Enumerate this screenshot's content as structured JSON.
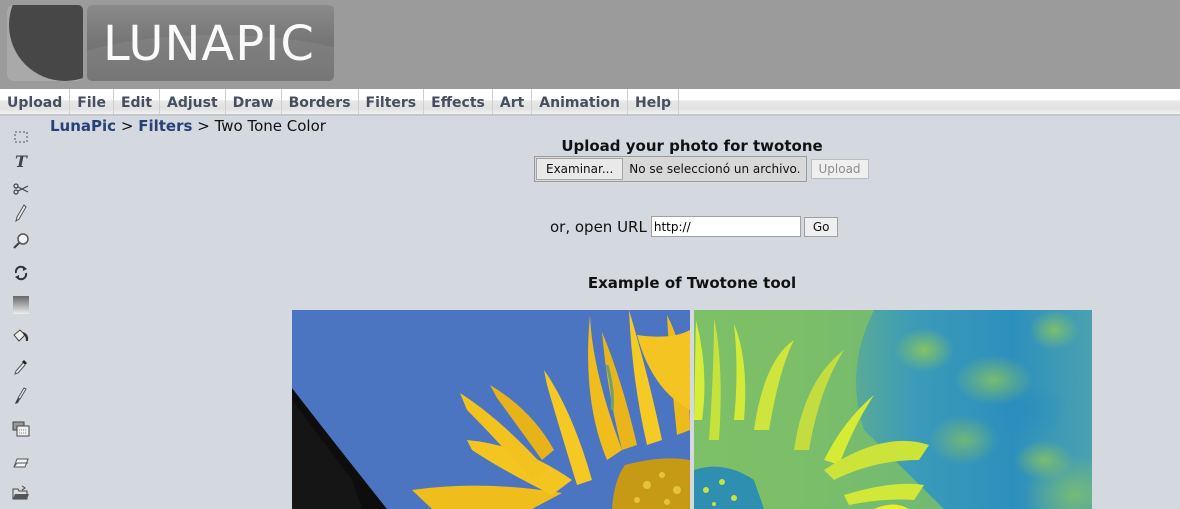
{
  "header": {
    "logo_text": "LUNAPIC"
  },
  "menu": {
    "items": [
      {
        "label": "Upload"
      },
      {
        "label": "File"
      },
      {
        "label": "Edit"
      },
      {
        "label": "Adjust"
      },
      {
        "label": "Draw"
      },
      {
        "label": "Borders"
      },
      {
        "label": "Filters"
      },
      {
        "label": "Effects"
      },
      {
        "label": "Art"
      },
      {
        "label": "Animation"
      },
      {
        "label": "Help"
      }
    ]
  },
  "toolbar": {
    "tools": [
      {
        "icon": "marquee-select-icon"
      },
      {
        "icon": "text-tool-icon"
      },
      {
        "icon": "scissors-icon"
      },
      {
        "icon": "pencil-icon"
      },
      {
        "icon": "magnifier-icon"
      },
      {
        "icon": "rotate-icon"
      },
      {
        "icon": "gradient-icon"
      },
      {
        "icon": "paint-bucket-icon"
      },
      {
        "icon": "eyedropper-icon"
      },
      {
        "icon": "brush-icon"
      },
      {
        "icon": "layers-icon"
      },
      {
        "icon": "eraser-icon"
      },
      {
        "icon": "open-folder-icon"
      }
    ]
  },
  "breadcrumb": {
    "root": "LunaPic",
    "section": "Filters",
    "current": "Two Tone Color",
    "separator": ">"
  },
  "upload": {
    "title": "Upload your photo for twotone",
    "browse_label": "Examinar...",
    "file_status": "No se seleccionó un archivo.",
    "upload_label": "Upload"
  },
  "url_open": {
    "label": "or, open URL",
    "value": "http://",
    "go_label": "Go"
  },
  "example": {
    "title": "Example of Twotone tool",
    "before_alt": "Original sunflower photo",
    "after_alt": "Twotone sunflower photo"
  },
  "colors": {
    "header_bg": "#9b9b9b",
    "page_bg": "#d4d8df",
    "menu_text": "#454f5f",
    "link": "#27407a"
  }
}
